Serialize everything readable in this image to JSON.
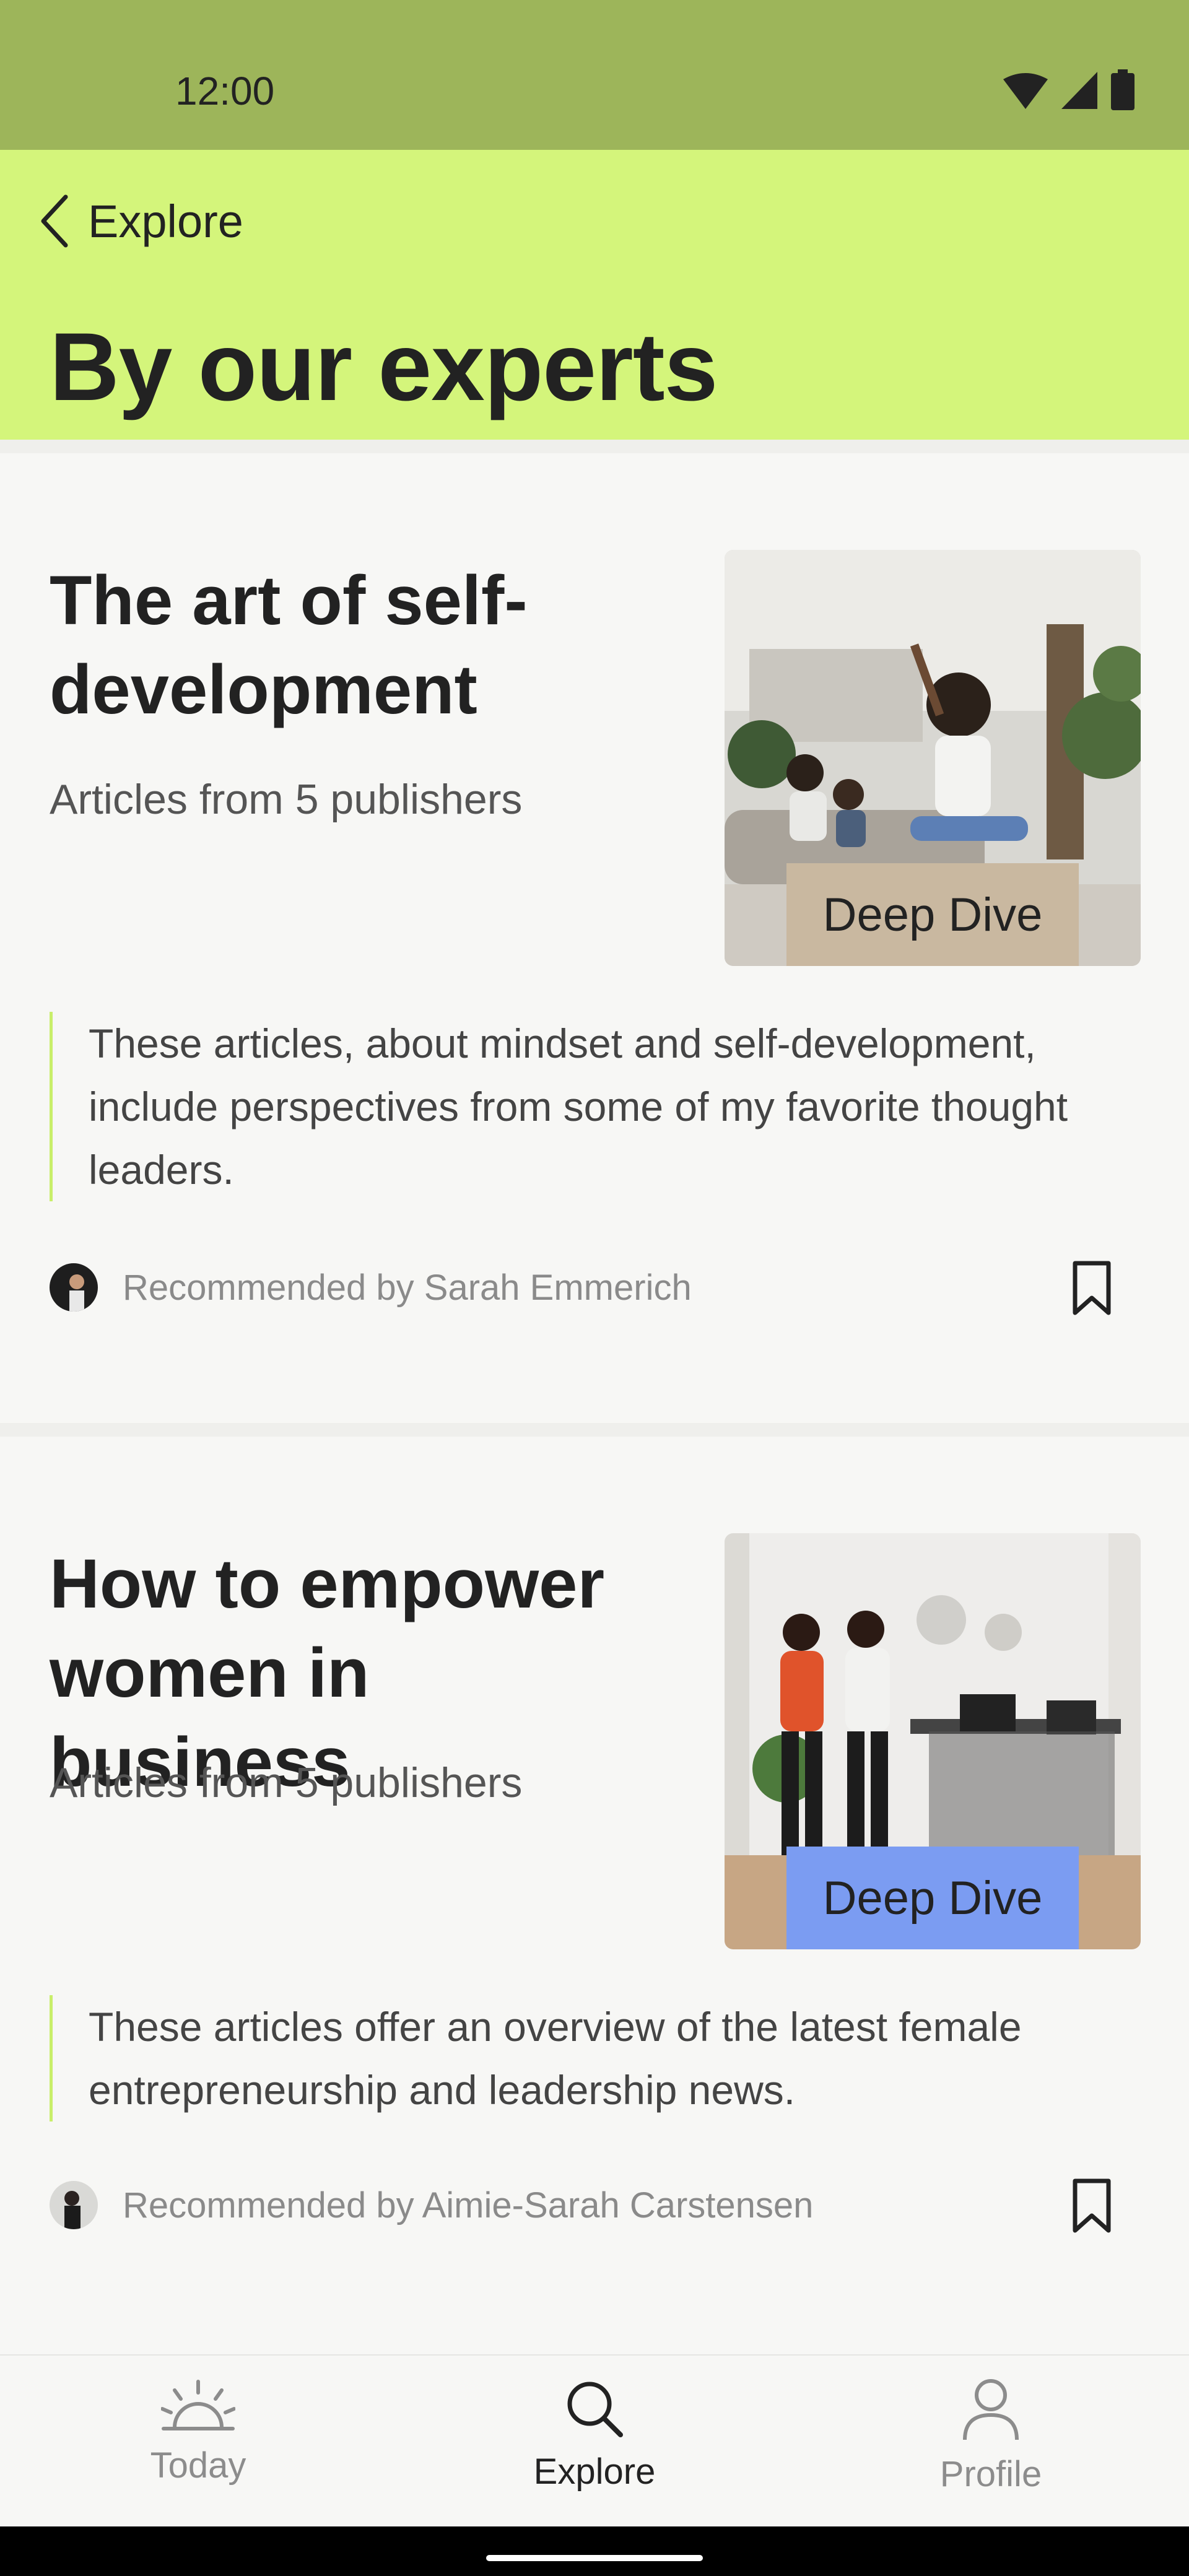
{
  "status_bar": {
    "time": "12:00"
  },
  "header": {
    "back_label": "Explore",
    "title": "By our experts"
  },
  "cards": [
    {
      "title": "The art of self-development",
      "subtitle": "Articles from 5 publishers",
      "badge": "Deep Dive",
      "badge_color": "#c9b8a0",
      "quote": "These articles, about mindset and self-development, include perspectives from some of my favorite thought leaders.",
      "recommended_by": "Recommended by Sarah Emmerich"
    },
    {
      "title": "How to empower women in business",
      "subtitle": "Articles from 5 publishers",
      "badge": "Deep Dive",
      "badge_color": "#7b9cf2",
      "quote": "These articles offer an overview of the latest female entrepreneurship and leadership news.",
      "recommended_by": "Recommended by Aimie-Sarah Carstensen"
    }
  ],
  "bottom_nav": {
    "items": [
      {
        "label": "Today",
        "icon": "sunrise-icon",
        "active": false
      },
      {
        "label": "Explore",
        "icon": "search-icon",
        "active": true
      },
      {
        "label": "Profile",
        "icon": "person-icon",
        "active": false
      }
    ]
  },
  "colors": {
    "status_bar": "#9db55a",
    "header": "#d4f57b",
    "quote_rule": "#c8ee6a"
  }
}
